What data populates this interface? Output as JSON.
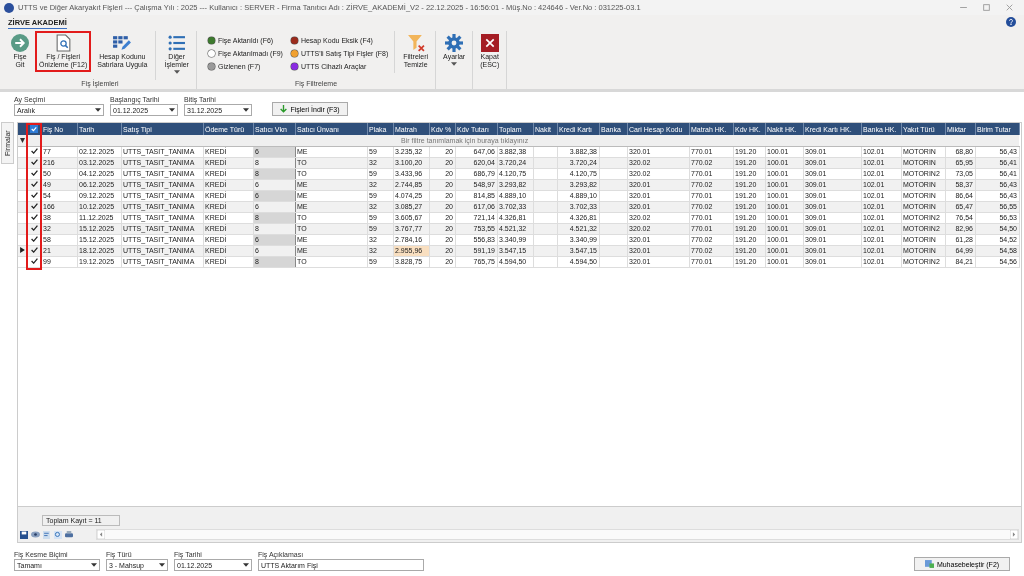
{
  "window": {
    "title": "UTTS ve Diğer Akaryakıt Fişleri  ---  Çalışma Yılı : 2025  ---  Kullanıcı : SERVER - Firma Tanıtıcı Adı : ZİRVE_AKADEMİ_V2 - 22.12.2025 - 16:56:01 - Müş.No : 424646 - Ver.No : 031225-03.1"
  },
  "ribbon": {
    "tab": "ZİRVE AKADEMİ",
    "groups": [
      {
        "label": "Fiş İşlemleri",
        "buttons": [
          {
            "lines": [
              "Fişe",
              "Git"
            ],
            "highlighted": false,
            "dropdown": false
          },
          {
            "lines": [
              "Fiş / Fişleri",
              "Önizleme (F12)"
            ],
            "highlighted": true,
            "dropdown": false
          },
          {
            "lines": [
              "Hesap Kodunu",
              "Satırlara Uygula"
            ],
            "highlighted": false,
            "dropdown": false
          },
          {
            "lines": [
              "Diğer",
              "İşlemler"
            ],
            "highlighted": false,
            "dropdown": true
          }
        ]
      },
      {
        "label": "Fiş Filtreleme",
        "legend": [
          {
            "label": "Fişe Aktarıldı (F6)",
            "color": "#3d7a2e"
          },
          {
            "label": "Fişe Aktarılmadı (F9)",
            "color": "#ffffff"
          },
          {
            "label": "Gizlenen (F7)",
            "color": "#9a9a9a"
          },
          {
            "label": "Hesap Kodu Eksik (F4)",
            "color": "#9b2b1c"
          },
          {
            "label": "UTTS'li Satış Tipi Fişler (F8)",
            "color": "#f0a030"
          },
          {
            "label": "UTTS Cihazlı Araçlar",
            "color": "#8a2be2"
          }
        ],
        "buttons": [
          {
            "lines": [
              "Filtreleri",
              "Temizle"
            ],
            "highlighted": false,
            "dropdown": false
          }
        ]
      },
      {
        "buttons": [
          {
            "lines": [
              "Ayarlar"
            ],
            "highlighted": false,
            "dropdown": true
          }
        ]
      },
      {
        "buttons": [
          {
            "lines": [
              "Kapat",
              "(ESC)"
            ],
            "highlighted": false,
            "dropdown": false
          }
        ]
      }
    ]
  },
  "filters": {
    "month": {
      "label": "Ay Seçimi",
      "value": "Aralık"
    },
    "start": {
      "label": "Başlangıç Tarihi",
      "value": "01.12.2025"
    },
    "end": {
      "label": "Bitiş Tarihi",
      "value": "31.12.2025"
    },
    "button": "Fişleri İndir (F3)"
  },
  "side_tab": "Firmalar",
  "grid": {
    "select_all_checked": true,
    "highlight_check_column": true,
    "filter_hint": "Bir filtre tanımlamak için buraya tıklayınız",
    "columns": [
      {
        "label": "Fiş No",
        "kind": "text"
      },
      {
        "label": "Tarih",
        "kind": "text"
      },
      {
        "label": "Satış Tipi",
        "kind": "text"
      },
      {
        "label": "Ödeme Türü",
        "kind": "text"
      },
      {
        "label": "Satıcı Vkn",
        "kind": "text"
      },
      {
        "label": "Satıcı Ünvanı",
        "kind": "text"
      },
      {
        "label": "Plaka",
        "kind": "text"
      },
      {
        "label": "Matrah",
        "kind": "text"
      },
      {
        "label": "Kdv %",
        "kind": "number"
      },
      {
        "label": "Kdv Tutarı",
        "kind": "number"
      },
      {
        "label": "Toplam",
        "kind": "text"
      },
      {
        "label": "Nakit",
        "kind": "number"
      },
      {
        "label": "Kredi Kartı",
        "kind": "number"
      },
      {
        "label": "Banka",
        "kind": "number"
      },
      {
        "label": "Cari Hesap Kodu",
        "kind": "text"
      },
      {
        "label": "Matrah HK.",
        "kind": "text"
      },
      {
        "label": "Kdv HK.",
        "kind": "text"
      },
      {
        "label": "Nakit HK.",
        "kind": "text"
      },
      {
        "label": "Kredi Kartı HK.",
        "kind": "text"
      },
      {
        "label": "Banka HK.",
        "kind": "text"
      },
      {
        "label": "Yakıt Türü",
        "kind": "text"
      },
      {
        "label": "Miktar",
        "kind": "number"
      },
      {
        "label": "Birim Tutar",
        "kind": "number"
      }
    ],
    "rows": [
      {
        "checked": true,
        "focused": false,
        "cells": [
          "77",
          "02.12.2025",
          "UTTS_TASIT_TANIMA",
          "KREDİ",
          "6",
          "ME",
          "59",
          "3.235,32",
          "20",
          "647,06",
          "3.882,38",
          null,
          "3.882,38",
          null,
          "320.01",
          "770.01",
          "191.20",
          "100.01",
          "309.01",
          "102.01",
          "MOTORIN",
          "68,80",
          "56,43"
        ]
      },
      {
        "checked": true,
        "focused": false,
        "cells": [
          "216",
          "03.12.2025",
          "UTTS_TASIT_TANIMA",
          "KREDİ",
          "8",
          "TO",
          "32",
          "3.100,20",
          "20",
          "620,04",
          "3.720,24",
          null,
          "3.720,24",
          null,
          "320.02",
          "770.02",
          "191.20",
          "100.01",
          "309.01",
          "102.01",
          "MOTORIN",
          "65,95",
          "56,41"
        ]
      },
      {
        "checked": true,
        "focused": false,
        "cells": [
          "50",
          "04.12.2025",
          "UTTS_TASIT_TANIMA",
          "KREDİ",
          "8",
          "TO",
          "59",
          "3.433,96",
          "20",
          "686,79",
          "4.120,75",
          null,
          "4.120,75",
          null,
          "320.02",
          "770.01",
          "191.20",
          "100.01",
          "309.01",
          "102.01",
          "MOTORIN2",
          "73,05",
          "56,41"
        ]
      },
      {
        "checked": true,
        "focused": false,
        "cells": [
          "49",
          "06.12.2025",
          "UTTS_TASIT_TANIMA",
          "KREDİ",
          "6",
          "ME",
          "32",
          "2.744,85",
          "20",
          "548,97",
          "3.293,82",
          null,
          "3.293,82",
          null,
          "320.01",
          "770.02",
          "191.20",
          "100.01",
          "309.01",
          "102.01",
          "MOTORIN",
          "58,37",
          "56,43"
        ]
      },
      {
        "checked": true,
        "focused": false,
        "cells": [
          "54",
          "09.12.2025",
          "UTTS_TASIT_TANIMA",
          "KREDİ",
          "6",
          "ME",
          "59",
          "4.074,25",
          "20",
          "814,85",
          "4.889,10",
          null,
          "4.889,10",
          null,
          "320.01",
          "770.01",
          "191.20",
          "100.01",
          "309.01",
          "102.01",
          "MOTORIN",
          "86,64",
          "56,43"
        ]
      },
      {
        "checked": true,
        "focused": false,
        "cells": [
          "166",
          "10.12.2025",
          "UTTS_TASIT_TANIMA",
          "KREDİ",
          "6",
          "ME",
          "32",
          "3.085,27",
          "20",
          "617,06",
          "3.702,33",
          null,
          "3.702,33",
          null,
          "320.01",
          "770.02",
          "191.20",
          "100.01",
          "309.01",
          "102.01",
          "MOTORIN",
          "65,47",
          "56,55"
        ]
      },
      {
        "checked": true,
        "focused": false,
        "cells": [
          "38",
          "11.12.2025",
          "UTTS_TASIT_TANIMA",
          "KREDİ",
          "8",
          "TO",
          "59",
          "3.605,67",
          "20",
          "721,14",
          "4.326,81",
          null,
          "4.326,81",
          null,
          "320.02",
          "770.01",
          "191.20",
          "100.01",
          "309.01",
          "102.01",
          "MOTORIN2",
          "76,54",
          "56,53"
        ]
      },
      {
        "checked": true,
        "focused": false,
        "cells": [
          "32",
          "15.12.2025",
          "UTTS_TASIT_TANIMA",
          "KREDİ",
          "8",
          "TO",
          "59",
          "3.767,77",
          "20",
          "753,55",
          "4.521,32",
          null,
          "4.521,32",
          null,
          "320.02",
          "770.01",
          "191.20",
          "100.01",
          "309.01",
          "102.01",
          "MOTORIN2",
          "82,96",
          "54,50"
        ]
      },
      {
        "checked": true,
        "focused": false,
        "cells": [
          "58",
          "15.12.2025",
          "UTTS_TASIT_TANIMA",
          "KREDİ",
          "6",
          "ME",
          "32",
          "2.784,16",
          "20",
          "556,83",
          "3.340,99",
          null,
          "3.340,99",
          null,
          "320.01",
          "770.02",
          "191.20",
          "100.01",
          "309.01",
          "102.01",
          "MOTORIN",
          "61,28",
          "54,52"
        ]
      },
      {
        "checked": true,
        "focused": true,
        "cells": [
          "21",
          "18.12.2025",
          "UTTS_TASIT_TANIMA",
          "KREDİ",
          "6",
          "ME",
          "32",
          "2.955,96",
          "20",
          "591,19",
          "3.547,15",
          null,
          "3.547,15",
          null,
          "320.01",
          "770.02",
          "191.20",
          "100.01",
          "309.01",
          "102.01",
          "MOTORIN",
          "64,99",
          "54,58"
        ]
      },
      {
        "checked": true,
        "focused": false,
        "cells": [
          "99",
          "19.12.2025",
          "UTTS_TASIT_TANIMA",
          "KREDİ",
          "8",
          "TO",
          "59",
          "3.828,75",
          "20",
          "765,75",
          "4.594,50",
          null,
          "4.594,50",
          null,
          "320.01",
          "770.01",
          "191.20",
          "100.01",
          "309.01",
          "102.01",
          "MOTORIN2",
          "84,21",
          "54,56"
        ]
      }
    ],
    "total": "Toplam Kayıt = 11"
  },
  "voucher": {
    "fields": [
      {
        "label": "Fiş Kesme Biçimi",
        "value": "Tamamı",
        "kind": "combo"
      },
      {
        "label": "Fiş Türü",
        "value": "3 - Mahsup",
        "kind": "combo"
      },
      {
        "label": "Fiş Tarihi",
        "value": "01.12.2025",
        "kind": "combo"
      },
      {
        "label": "Fiş Açıklaması",
        "value": "UTTS Aktarım Fişi",
        "kind": "text"
      }
    ],
    "button": "Muhasebeleştir (F2)"
  }
}
